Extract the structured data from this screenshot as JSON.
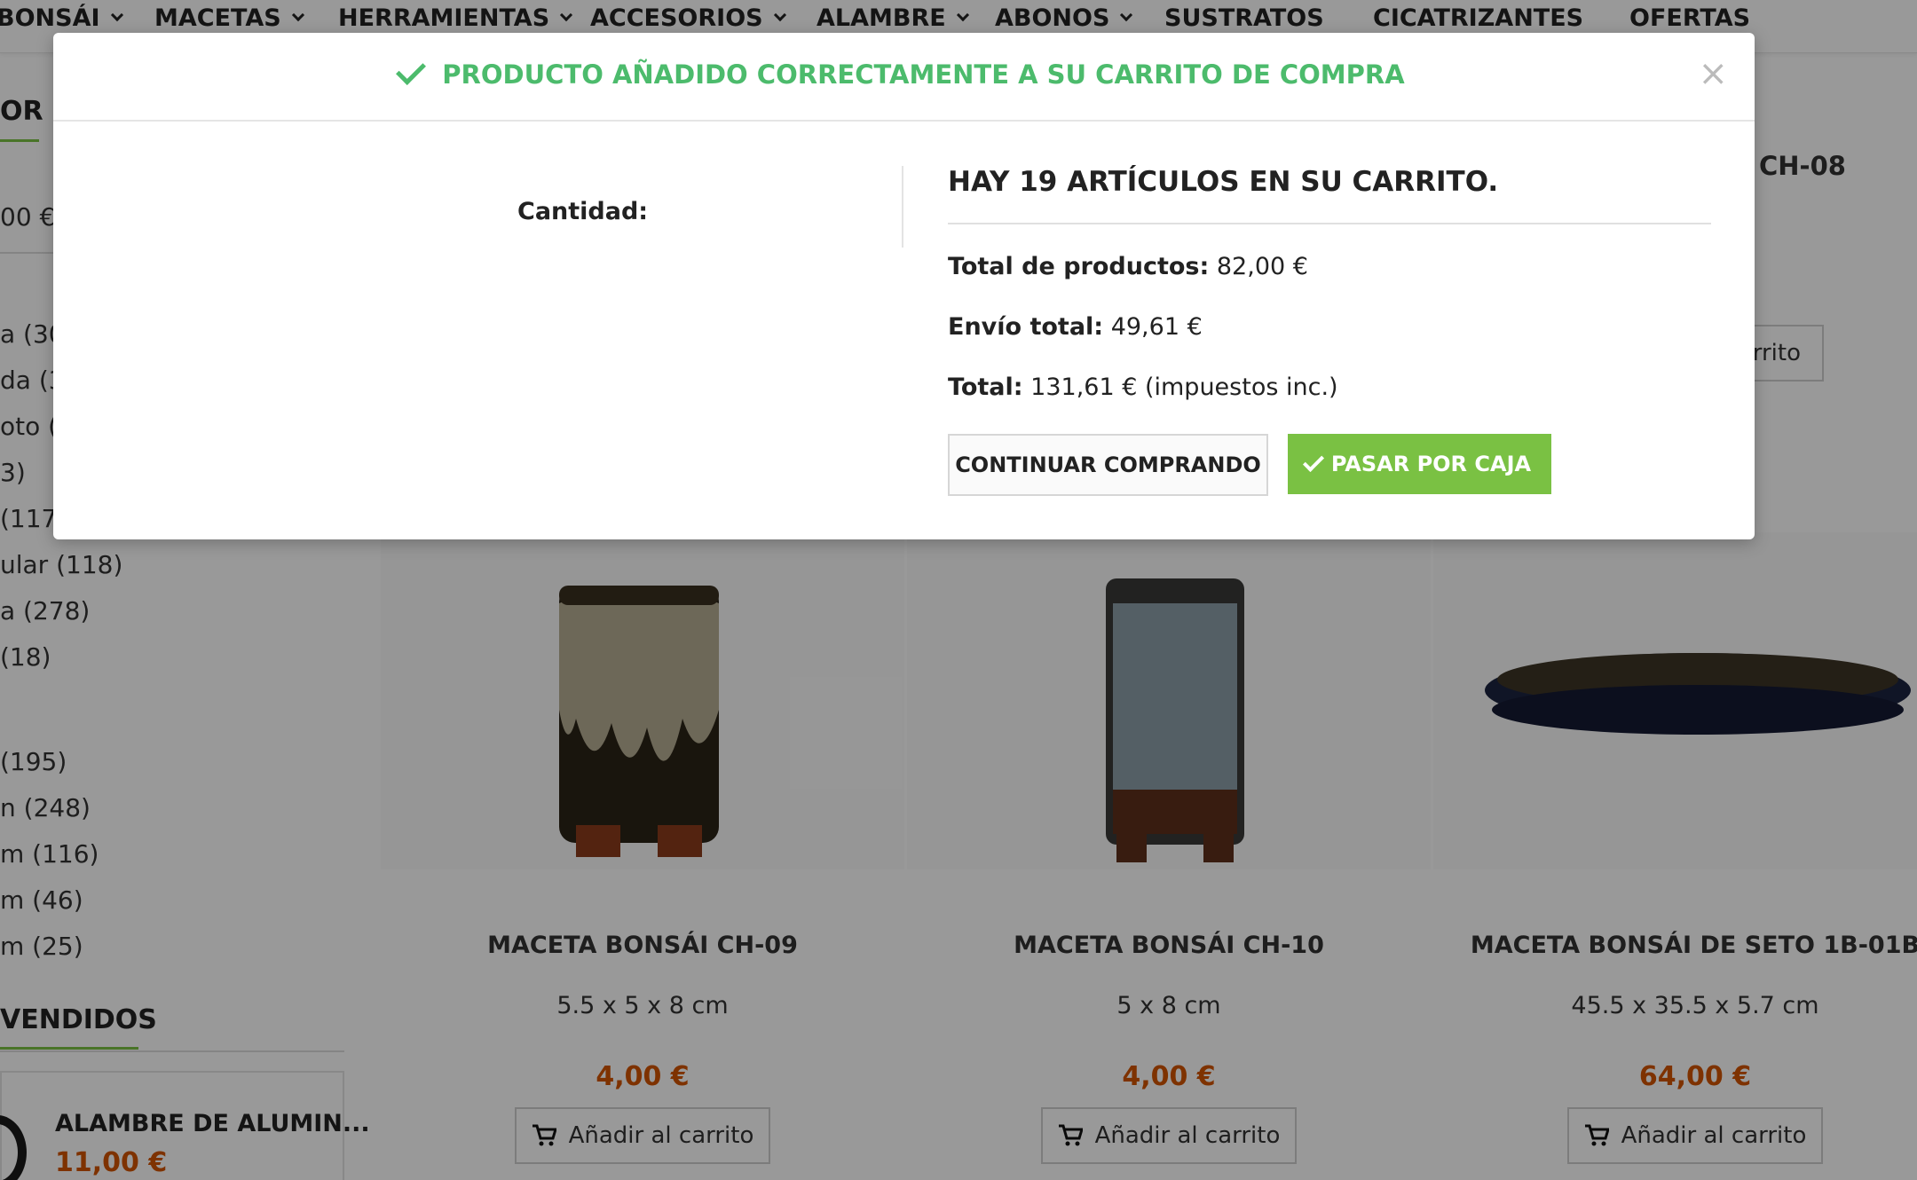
{
  "nav": {
    "items": [
      {
        "label": "BONSÁI",
        "has_dropdown": true
      },
      {
        "label": "MACETAS",
        "has_dropdown": true
      },
      {
        "label": "HERRAMIENTAS",
        "has_dropdown": true
      },
      {
        "label": "ACCESORIOS",
        "has_dropdown": true
      },
      {
        "label": "ALAMBRE",
        "has_dropdown": true
      },
      {
        "label": "ABONOS",
        "has_dropdown": true
      },
      {
        "label": "SUSTRATOS",
        "has_dropdown": false
      },
      {
        "label": "CICATRIZANTES",
        "has_dropdown": false
      },
      {
        "label": "OFERTAS",
        "has_dropdown": false
      }
    ]
  },
  "sidebar": {
    "filter_heading": "OR",
    "price_range": "00 €",
    "facets": [
      "a (30",
      "da (3",
      "oto (",
      "3)",
      "(117)",
      "ular (118)",
      "a (278)",
      " (18)",
      " (195)",
      "n (248)",
      "m (116)",
      "m (46)",
      "m (25)"
    ],
    "bestsellers_heading": "VENDIDOS",
    "bestseller": {
      "name": "ALAMBRE DE ALUMIN...",
      "price": "11,00 €"
    }
  },
  "background_products": {
    "partial_top_name": "CH-08",
    "partial_top_cart": "arrito",
    "cart_label": "Añadir al carrito",
    "items": [
      {
        "name": "MACETA BONSÁI CH-09",
        "dims": "5.5 x 5 x 8 cm",
        "price": "4,00 €"
      },
      {
        "name": "MACETA BONSÁI CH-10",
        "dims": "5 x 8 cm",
        "price": "4,00 €"
      },
      {
        "name": "MACETA BONSÁI DE SETO 1B-01B",
        "dims": "45.5 x 35.5 x 5.7 cm",
        "price": "64,00 €"
      }
    ]
  },
  "modal": {
    "title": "PRODUCTO AÑADIDO CORRECTAMENTE A SU CARRITO DE COMPRA",
    "close_symbol": "×",
    "quantity_label": "Cantidad:",
    "summary_title": "HAY 19 ARTÍCULOS EN SU CARRITO.",
    "total_products_label": "Total de productos:",
    "total_products_value": "82,00 €",
    "shipping_label": "Envío total:",
    "shipping_value": "49,61 €",
    "total_label": "Total:",
    "total_value": "131,61 € (impuestos inc.)",
    "continue_button": "CONTINUAR COMPRANDO",
    "checkout_button": "PASAR POR CAJA"
  },
  "colors": {
    "accent_green": "#7ac143",
    "success_text": "#4cbb6c",
    "price_orange": "#d35400"
  }
}
